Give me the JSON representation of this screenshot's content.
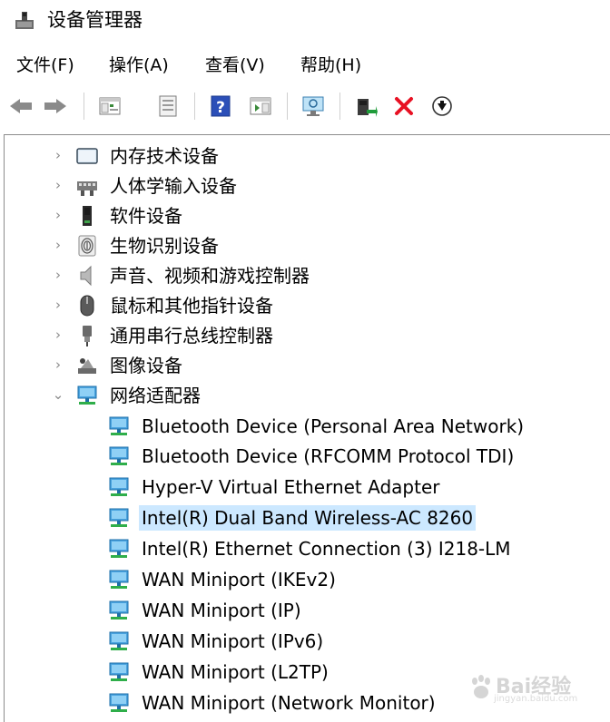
{
  "window": {
    "title": "设备管理器"
  },
  "menu": [
    {
      "label": "文件(F)"
    },
    {
      "label": "操作(A)"
    },
    {
      "label": "查看(V)"
    },
    {
      "label": "帮助(H)"
    }
  ],
  "toolbar": [
    {
      "icon": "back-arrow-icon"
    },
    {
      "icon": "forward-arrow-icon"
    },
    {
      "icon": "show-hide-console-tree-icon"
    },
    {
      "icon": "properties-icon"
    },
    {
      "icon": "help-icon"
    },
    {
      "icon": "action-pane-icon"
    },
    {
      "icon": "scan-hardware-changes-icon"
    },
    {
      "icon": "update-driver-icon"
    },
    {
      "icon": "uninstall-device-icon"
    },
    {
      "icon": "disable-device-icon"
    }
  ],
  "tree": {
    "categories": [
      {
        "label": "内存技术设备",
        "icon": "memory-device-icon",
        "expanded": false
      },
      {
        "label": "人体学输入设备",
        "icon": "hid-device-icon",
        "expanded": false
      },
      {
        "label": "软件设备",
        "icon": "software-device-icon",
        "expanded": false
      },
      {
        "label": "生物识别设备",
        "icon": "biometric-device-icon",
        "expanded": false
      },
      {
        "label": "声音、视频和游戏控制器",
        "icon": "speaker-icon",
        "expanded": false
      },
      {
        "label": "鼠标和其他指针设备",
        "icon": "mouse-icon",
        "expanded": false
      },
      {
        "label": "通用串行总线控制器",
        "icon": "usb-plug-icon",
        "expanded": false
      },
      {
        "label": "图像设备",
        "icon": "camera-icon",
        "expanded": false
      },
      {
        "label": "网络适配器",
        "icon": "network-adapter-icon",
        "expanded": true
      }
    ],
    "network_adapters": [
      {
        "label": "Bluetooth Device (Personal Area Network)",
        "selected": false
      },
      {
        "label": "Bluetooth Device (RFCOMM Protocol TDI)",
        "selected": false
      },
      {
        "label": "Hyper-V Virtual Ethernet Adapter",
        "selected": false
      },
      {
        "label": "Intel(R) Dual Band Wireless-AC 8260",
        "selected": true
      },
      {
        "label": "Intel(R) Ethernet Connection (3) I218-LM",
        "selected": false
      },
      {
        "label": "WAN Miniport (IKEv2)",
        "selected": false
      },
      {
        "label": "WAN Miniport (IP)",
        "selected": false
      },
      {
        "label": "WAN Miniport (IPv6)",
        "selected": false
      },
      {
        "label": "WAN Miniport (L2TP)",
        "selected": false
      },
      {
        "label": "WAN Miniport (Network Monitor)",
        "selected": false
      }
    ]
  },
  "watermark": {
    "text": "Bai经验",
    "sub": "jingyan.baidu.com"
  },
  "colors": {
    "selection": "#cce8ff",
    "accent": "#1e90d6",
    "delete_red": "#e81123"
  }
}
